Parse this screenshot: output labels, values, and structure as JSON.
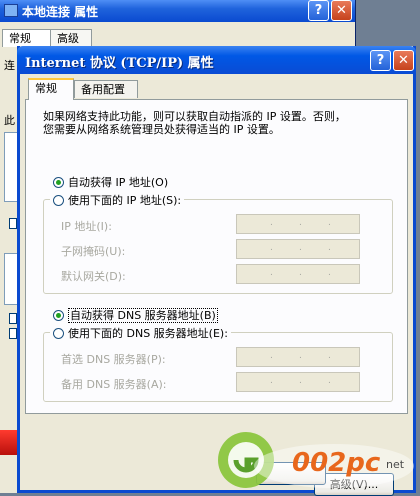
{
  "back_window": {
    "title": "本地连接 属性",
    "help_button": "?",
    "close_button": "✕",
    "tabs": [
      "常规",
      "高级"
    ],
    "fragments": [
      "连",
      "此"
    ]
  },
  "dialog": {
    "title": "Internet 协议 (TCP/IP) 属性",
    "help_button": "?",
    "close_button": "✕",
    "tabs": [
      {
        "label": "常规",
        "active": true
      },
      {
        "label": "备用配置",
        "active": false
      }
    ],
    "description_line1": "如果网络支持此功能，则可以获取自动指派的 IP 设置。否则，",
    "description_line2": "您需要从网络系统管理员处获得适当的 IP 设置。",
    "ip_auto": {
      "label": "自动获得 IP 地址(O)",
      "checked": true
    },
    "ip_manual": {
      "label": "使用下面的 IP 地址(S):",
      "checked": false
    },
    "ip_fields": [
      {
        "label": "IP 地址(I):",
        "value": ""
      },
      {
        "label": "子网掩码(U):",
        "value": ""
      },
      {
        "label": "默认网关(D):",
        "value": ""
      }
    ],
    "dns_auto": {
      "label": "自动获得 DNS 服务器地址(B)",
      "checked": true
    },
    "dns_manual": {
      "label": "使用下面的 DNS 服务器地址(E):",
      "checked": false
    },
    "dns_fields": [
      {
        "label": "首选 DNS 服务器(P):",
        "value": ""
      },
      {
        "label": "备用 DNS 服务器(A):",
        "value": ""
      }
    ],
    "advanced_button": "高级(V)..."
  },
  "watermark": {
    "text": "002pc",
    "suffix": "net"
  }
}
